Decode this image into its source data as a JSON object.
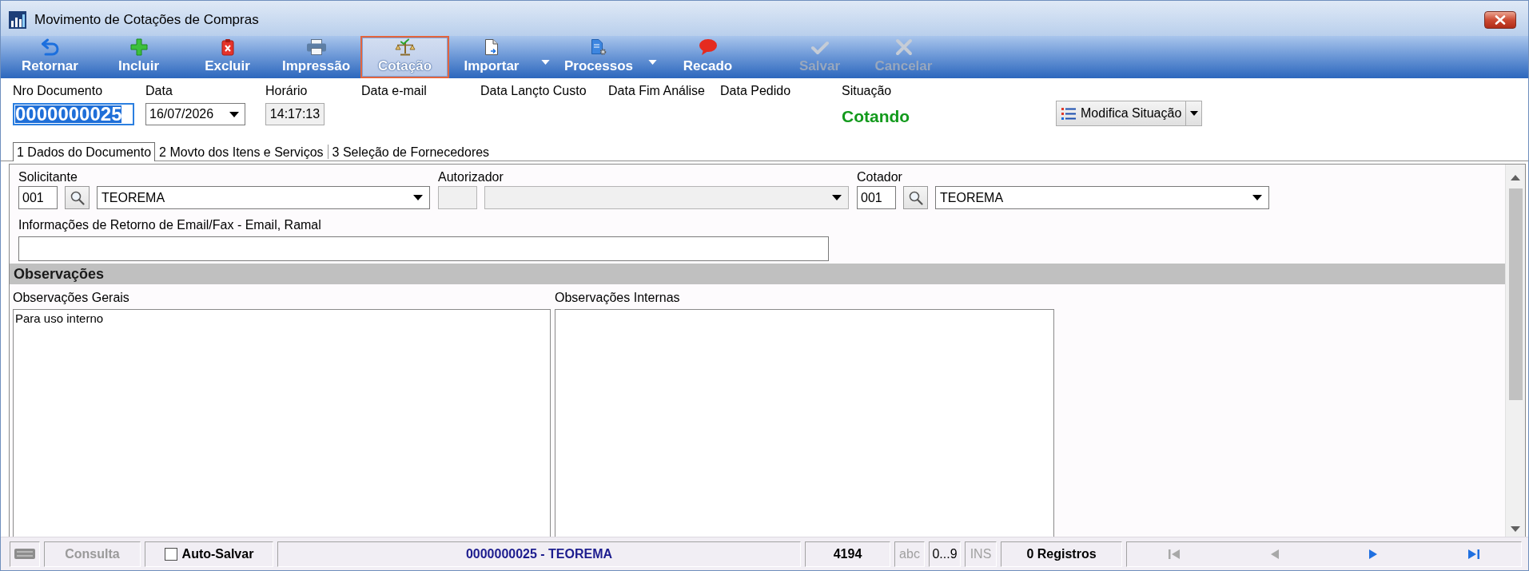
{
  "window": {
    "title": "Movimento de Cotações de Compras"
  },
  "toolbar": {
    "buttons": [
      {
        "label": "Retornar",
        "kind": "plain",
        "selected": false,
        "disabled": false
      },
      {
        "label": "Incluir",
        "kind": "plain",
        "selected": false,
        "disabled": false
      },
      {
        "label": "Excluir",
        "kind": "plain",
        "selected": false,
        "disabled": false
      },
      {
        "label": "Impressão",
        "kind": "plain",
        "selected": false,
        "disabled": false
      },
      {
        "label": "Cotação",
        "kind": "plain",
        "selected": true,
        "disabled": false
      },
      {
        "label": "Importar",
        "kind": "split",
        "selected": false,
        "disabled": false
      },
      {
        "label": "Processos",
        "kind": "split",
        "selected": false,
        "disabled": false
      },
      {
        "label": "Recado",
        "kind": "plain",
        "selected": false,
        "disabled": false
      }
    ],
    "edit_buttons": [
      {
        "label": "Salvar",
        "disabled": true
      },
      {
        "label": "Cancelar",
        "disabled": true
      }
    ]
  },
  "header": {
    "fields": [
      {
        "kind": "text",
        "label": "Nro Documento",
        "value": "0000000025",
        "focused": true
      },
      {
        "kind": "date",
        "label": "Data",
        "value": "16/07/2026"
      },
      {
        "kind": "readonly",
        "label": "Horário",
        "value": "14:17:13"
      },
      {
        "kind": "label",
        "label": "Data e-mail"
      },
      {
        "kind": "label",
        "label": "Data Lançto Custo"
      },
      {
        "kind": "label",
        "label": "Data Fim Análise"
      },
      {
        "kind": "label",
        "label": "Data Pedido"
      },
      {
        "kind": "status",
        "label": "Situação",
        "value": "Cotando"
      }
    ],
    "modify_button": {
      "label": "Modifica Situação"
    }
  },
  "tabs": [
    {
      "label": "1 Dados do Documento",
      "selected": true
    },
    {
      "label": "2 Movto dos Itens e Serviços",
      "selected": false
    },
    {
      "label": "3 Seleção de Fornecedores",
      "selected": false
    }
  ],
  "form": {
    "people": [
      {
        "label": "Solicitante",
        "kind": "lookup",
        "code": "001",
        "name": "TEOREMA",
        "disabled": false
      },
      {
        "label": "Autorizador",
        "kind": "plain",
        "disabled": true
      },
      {
        "label": "Cotador",
        "kind": "lookup",
        "code": "001",
        "name": "TEOREMA",
        "disabled": false
      }
    ],
    "return_info": {
      "label": "Informações de Retorno de Email/Fax - Email, Ramal"
    },
    "observations": {
      "title": "Observações",
      "notes": [
        {
          "label": "Observações Gerais",
          "value": "Para uso interno"
        },
        {
          "label": "Observações Internas"
        }
      ]
    }
  },
  "status_bar": {
    "mode": "Consulta",
    "auto_save": {
      "label": "Auto-Salvar",
      "checked": false
    },
    "record": "0000000025 - TEOREMA",
    "count": "4194",
    "indicators": [
      {
        "label": "abc",
        "active": false
      },
      {
        "label": "0...9",
        "active": true
      },
      {
        "label": "INS",
        "active": false
      }
    ],
    "records": "0 Registros",
    "navigation": [
      {
        "kind": "first",
        "disabled": true
      },
      {
        "kind": "previous",
        "disabled": true
      },
      {
        "kind": "next",
        "disabled": false
      },
      {
        "kind": "last",
        "disabled": false
      }
    ]
  }
}
